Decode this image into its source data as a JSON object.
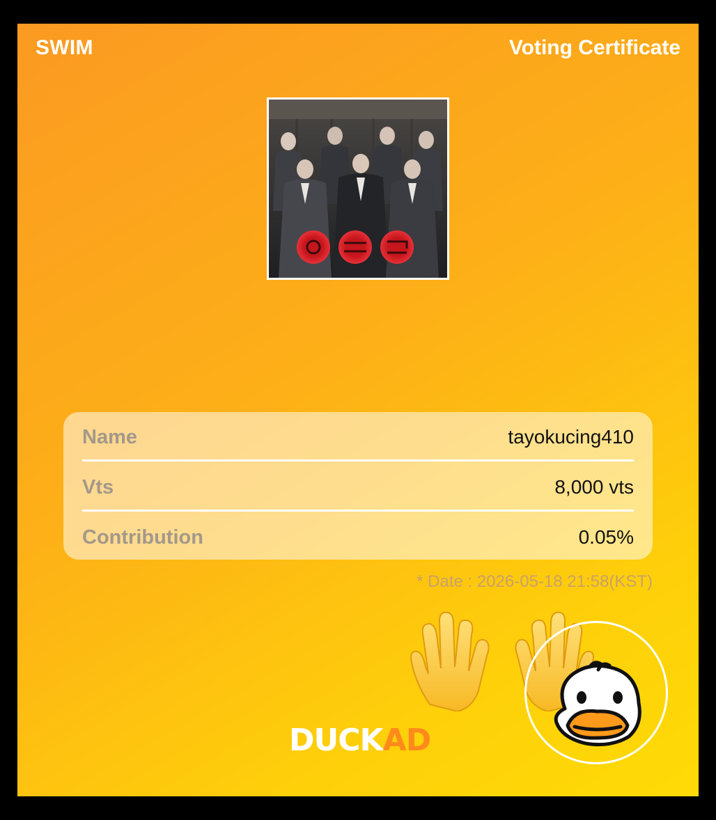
{
  "header": {
    "brand": "SWIM",
    "title": "Voting Certificate"
  },
  "album": {
    "alt": "Group photo album cover"
  },
  "info": {
    "rows": [
      {
        "label": "Name",
        "value": "tayokucing410"
      },
      {
        "label": "Vts",
        "value": "8,000 vts"
      },
      {
        "label": "Contribution",
        "value": "0.05%"
      }
    ]
  },
  "date_text": "* Date : 2026-05-18 21:58(KST)",
  "footer": {
    "logo_part1": "DUCK",
    "logo_part2": "AD"
  },
  "icons": {
    "hands": "raised-hands-icon",
    "duck": "duck-mascot-icon"
  },
  "colors": {
    "gradient_start": "#fb9a22",
    "gradient_end": "#ffdb06",
    "logo_accent": "#ff8a1c",
    "label_gray": "#a3988a"
  }
}
